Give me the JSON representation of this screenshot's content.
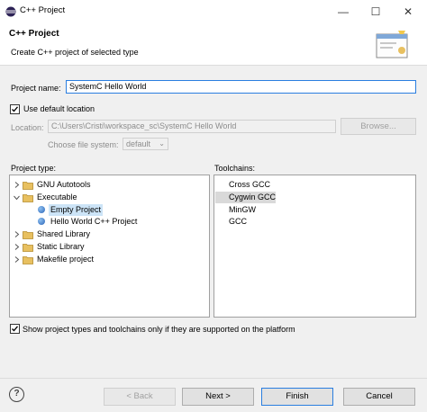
{
  "window": {
    "title": "C++ Project",
    "minimize": "—",
    "maximize": "☐",
    "close": "✕"
  },
  "header": {
    "title": "C++ Project",
    "description": "Create C++ project of selected type"
  },
  "form": {
    "project_name_label": "Project name:",
    "project_name_value": "SystemC Hello World",
    "use_default_location_label": "Use default location",
    "use_default_location_checked": true,
    "location_label": "Location:",
    "location_value": "C:\\Users\\Cristi\\workspace_sc\\SystemC Hello World",
    "browse_label": "Browse...",
    "file_system_label": "Choose file system:",
    "file_system_value": "default"
  },
  "project_type": {
    "label": "Project type:",
    "items": [
      {
        "label": "GNU Autotools",
        "icon": "folder-icon",
        "expander": "collapsed"
      },
      {
        "label": "Executable",
        "icon": "folder-icon",
        "expander": "expanded"
      },
      {
        "label": "Empty Project",
        "icon": "bullet-icon",
        "expander": "none",
        "selected": true
      },
      {
        "label": "Hello World C++ Project",
        "icon": "bullet-icon",
        "expander": "none"
      },
      {
        "label": "Shared Library",
        "icon": "folder-icon",
        "expander": "collapsed"
      },
      {
        "label": "Static Library",
        "icon": "folder-icon",
        "expander": "collapsed"
      },
      {
        "label": "Makefile project",
        "icon": "folder-icon",
        "expander": "collapsed"
      }
    ]
  },
  "toolchains": {
    "label": "Toolchains:",
    "items": [
      {
        "label": "Cross GCC"
      },
      {
        "label": "Cygwin GCC",
        "selected": true
      },
      {
        "label": "MinGW GCC"
      }
    ]
  },
  "filter_checkbox": {
    "label": "Show project types and toolchains only if they are supported on the platform",
    "checked": true
  },
  "buttons": {
    "back": "< Back",
    "next": "Next >",
    "finish": "Finish",
    "cancel": "Cancel"
  },
  "help_icon": "?",
  "colors": {
    "selection": "#cce4f7",
    "focus_border": "#2a7ee0",
    "folder": "#e8c060"
  }
}
